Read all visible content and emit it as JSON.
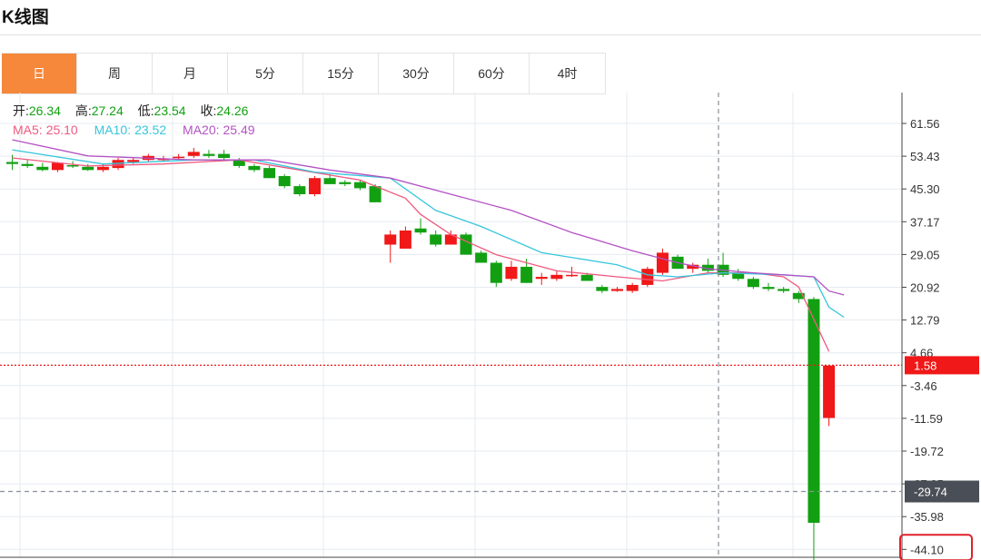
{
  "page": {
    "title": "K线图"
  },
  "tabs": [
    {
      "label": "日",
      "active": true
    },
    {
      "label": "周",
      "active": false
    },
    {
      "label": "月",
      "active": false
    },
    {
      "label": "5分",
      "active": false
    },
    {
      "label": "15分",
      "active": false
    },
    {
      "label": "30分",
      "active": false
    },
    {
      "label": "60分",
      "active": false
    },
    {
      "label": "4时",
      "active": false
    }
  ],
  "info": {
    "open_label": "开:",
    "open": "26.34",
    "high_label": "高:",
    "high": "27.24",
    "low_label": "低:",
    "low": "23.54",
    "close_label": "收:",
    "close": "24.26",
    "ma5_label": "MA5:",
    "ma5": "25.10",
    "ma10_label": "MA10:",
    "ma10": "23.52",
    "ma20_label": "MA20:",
    "ma20": "25.49"
  },
  "colors": {
    "up": "#f01818",
    "down": "#12a012",
    "ma5": "#ef5a7e",
    "ma10": "#36c6dc",
    "ma20": "#b451c4",
    "last_price": "#f01818",
    "crosshair": "#8a8f99",
    "crosshair_badge": "#4a4e56",
    "grid": "#e6ebf1",
    "highlight_box": "#e0202a"
  },
  "chart_data": {
    "type": "candlestick",
    "y_ticks": [
      "61.56",
      "53.43",
      "45.30",
      "37.17",
      "29.05",
      "20.92",
      "12.79",
      "4.66",
      "-3.46",
      "-11.59",
      "-19.72",
      "-27.85",
      "-35.98",
      "-44.10"
    ],
    "ylim": [
      -44.1,
      61.56
    ],
    "grid": true,
    "last_price_label": "1.58",
    "last_price": 1.58,
    "crosshair_label": "-29.74",
    "crosshair_value": -29.74,
    "highlighted_label": "-44.10",
    "ohlc_fields": [
      "open",
      "high",
      "low",
      "close"
    ],
    "candles": [
      [
        52.0,
        53.8,
        50.0,
        51.5
      ],
      [
        51.5,
        52.5,
        50.5,
        51.0
      ],
      [
        50.8,
        51.8,
        49.7,
        50.0
      ],
      [
        50.0,
        52.0,
        49.5,
        51.8
      ],
      [
        51.2,
        52.2,
        50.5,
        51.0
      ],
      [
        50.8,
        51.5,
        49.8,
        50.0
      ],
      [
        50.0,
        51.5,
        49.5,
        50.8
      ],
      [
        50.5,
        53.0,
        50.0,
        52.5
      ],
      [
        52.0,
        53.0,
        51.5,
        52.5
      ],
      [
        52.5,
        54.0,
        52.0,
        53.5
      ],
      [
        52.5,
        53.5,
        52.0,
        52.8
      ],
      [
        53.0,
        54.0,
        52.5,
        53.3
      ],
      [
        53.5,
        55.5,
        53.0,
        54.5
      ],
      [
        54.0,
        55.0,
        53.0,
        53.5
      ],
      [
        54.0,
        55.0,
        52.5,
        53.0
      ],
      [
        52.5,
        53.0,
        50.5,
        51.0
      ],
      [
        51.0,
        51.5,
        49.5,
        50.0
      ],
      [
        50.5,
        51.0,
        48.0,
        48.0
      ],
      [
        48.5,
        49.0,
        45.5,
        46.0
      ],
      [
        46.0,
        46.5,
        43.5,
        44.0
      ],
      [
        44.0,
        48.5,
        43.5,
        48.0
      ],
      [
        48.0,
        49.0,
        46.5,
        46.5
      ],
      [
        47.0,
        47.5,
        46.0,
        46.5
      ],
      [
        47.0,
        47.5,
        45.0,
        45.5
      ],
      [
        46.0,
        46.5,
        42.0,
        42.0
      ],
      [
        31.5,
        35.0,
        27.0,
        34.0
      ],
      [
        30.5,
        36.0,
        30.5,
        35.0
      ],
      [
        35.5,
        38.0,
        34.0,
        34.5
      ],
      [
        34.0,
        35.0,
        31.0,
        31.5
      ],
      [
        31.5,
        35.0,
        31.5,
        34.0
      ],
      [
        34.0,
        34.5,
        29.0,
        29.0
      ],
      [
        29.5,
        30.0,
        27.0,
        27.0
      ],
      [
        27.0,
        27.5,
        21.0,
        22.0
      ],
      [
        23.0,
        27.5,
        22.5,
        26.0
      ],
      [
        26.0,
        28.0,
        22.0,
        22.0
      ],
      [
        23.0,
        24.5,
        21.5,
        23.5
      ],
      [
        23.0,
        25.0,
        22.5,
        24.0
      ],
      [
        24.0,
        26.0,
        23.5,
        24.0
      ],
      [
        24.0,
        24.5,
        22.5,
        22.5
      ],
      [
        21.0,
        21.5,
        19.5,
        20.0
      ],
      [
        20.0,
        21.0,
        19.8,
        20.5
      ],
      [
        20.0,
        22.0,
        19.5,
        21.5
      ],
      [
        21.5,
        26.0,
        21.0,
        25.5
      ],
      [
        24.5,
        30.5,
        24.0,
        29.5
      ],
      [
        28.5,
        29.0,
        25.5,
        25.5
      ],
      [
        25.5,
        27.0,
        24.5,
        26.5
      ],
      [
        26.5,
        28.0,
        24.5,
        25.0
      ],
      [
        26.5,
        29.5,
        23.5,
        24.0
      ],
      [
        24.5,
        25.5,
        22.5,
        23.0
      ],
      [
        23.0,
        23.5,
        20.5,
        21.0
      ],
      [
        21.0,
        22.0,
        20.0,
        20.5
      ],
      [
        20.5,
        21.0,
        19.5,
        20.0
      ],
      [
        19.5,
        20.0,
        17.0,
        18.0
      ],
      [
        18.0,
        18.5,
        -47.0,
        -37.5
      ],
      [
        -11.5,
        1.5,
        -13.5,
        1.5
      ]
    ],
    "ma_series": [
      {
        "name": "MA5",
        "points": [
          [
            0,
            53.0
          ],
          [
            5,
            51.0
          ],
          [
            10,
            51.5
          ],
          [
            15,
            52.5
          ],
          [
            19,
            50.0
          ],
          [
            23,
            47.5
          ],
          [
            26,
            43.0
          ],
          [
            27,
            39.0
          ],
          [
            29,
            34.0
          ],
          [
            32,
            29.0
          ],
          [
            36,
            25.0
          ],
          [
            40,
            23.5
          ],
          [
            43,
            22.5
          ],
          [
            46,
            24.5
          ],
          [
            49,
            24.5
          ],
          [
            51,
            23.5
          ],
          [
            52,
            21.0
          ],
          [
            53,
            13.0
          ],
          [
            54,
            5.0
          ]
        ]
      },
      {
        "name": "MA10",
        "points": [
          [
            0,
            55.0
          ],
          [
            6,
            51.5
          ],
          [
            12,
            52.5
          ],
          [
            16,
            52.5
          ],
          [
            20,
            49.5
          ],
          [
            25,
            48.0
          ],
          [
            28,
            40.0
          ],
          [
            31,
            36.0
          ],
          [
            35,
            29.5
          ],
          [
            40,
            26.5
          ],
          [
            42,
            24.0
          ],
          [
            44,
            23.5
          ],
          [
            47,
            24.5
          ],
          [
            51,
            24.0
          ],
          [
            53,
            23.5
          ],
          [
            54,
            16.0
          ],
          [
            55,
            13.5
          ]
        ]
      },
      {
        "name": "MA20",
        "points": [
          [
            0,
            57.5
          ],
          [
            5,
            53.5
          ],
          [
            12,
            52.5
          ],
          [
            17,
            52.5
          ],
          [
            21,
            50.0
          ],
          [
            25,
            48.0
          ],
          [
            29,
            44.0
          ],
          [
            33,
            40.0
          ],
          [
            37,
            34.5
          ],
          [
            41,
            30.0
          ],
          [
            44,
            27.0
          ],
          [
            46,
            25.5
          ],
          [
            49,
            24.5
          ],
          [
            51,
            24.0
          ],
          [
            53,
            23.5
          ],
          [
            54,
            20.0
          ],
          [
            55,
            19.0
          ]
        ]
      }
    ]
  }
}
